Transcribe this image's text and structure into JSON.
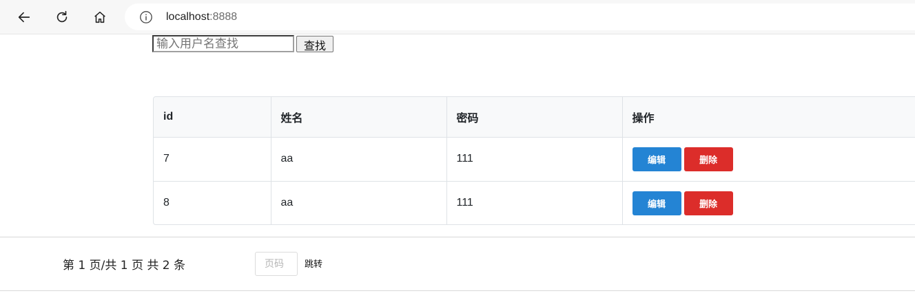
{
  "browser": {
    "url_host": "localhost",
    "url_port": ":8888",
    "icons": {
      "back": "back-arrow-icon",
      "reload": "reload-icon",
      "home": "home-icon",
      "info": "info-icon"
    }
  },
  "search": {
    "placeholder": "输入用户名查找",
    "button_label": "查找"
  },
  "table": {
    "headers": [
      "id",
      "姓名",
      "密码",
      "操作"
    ],
    "rows": [
      {
        "id": "7",
        "name": "aa",
        "password": "111",
        "edit_label": "编辑",
        "delete_label": "删除"
      },
      {
        "id": "8",
        "name": "aa",
        "password": "111",
        "edit_label": "编辑",
        "delete_label": "删除"
      }
    ]
  },
  "pagination": {
    "info": "第 1 页/共 1 页 共 2 条",
    "page_placeholder": "页码",
    "jump_label": "跳转"
  },
  "colors": {
    "edit_button": "#2484d4",
    "delete_button": "#dc2d2a",
    "table_header_bg": "#f8f9fa"
  }
}
